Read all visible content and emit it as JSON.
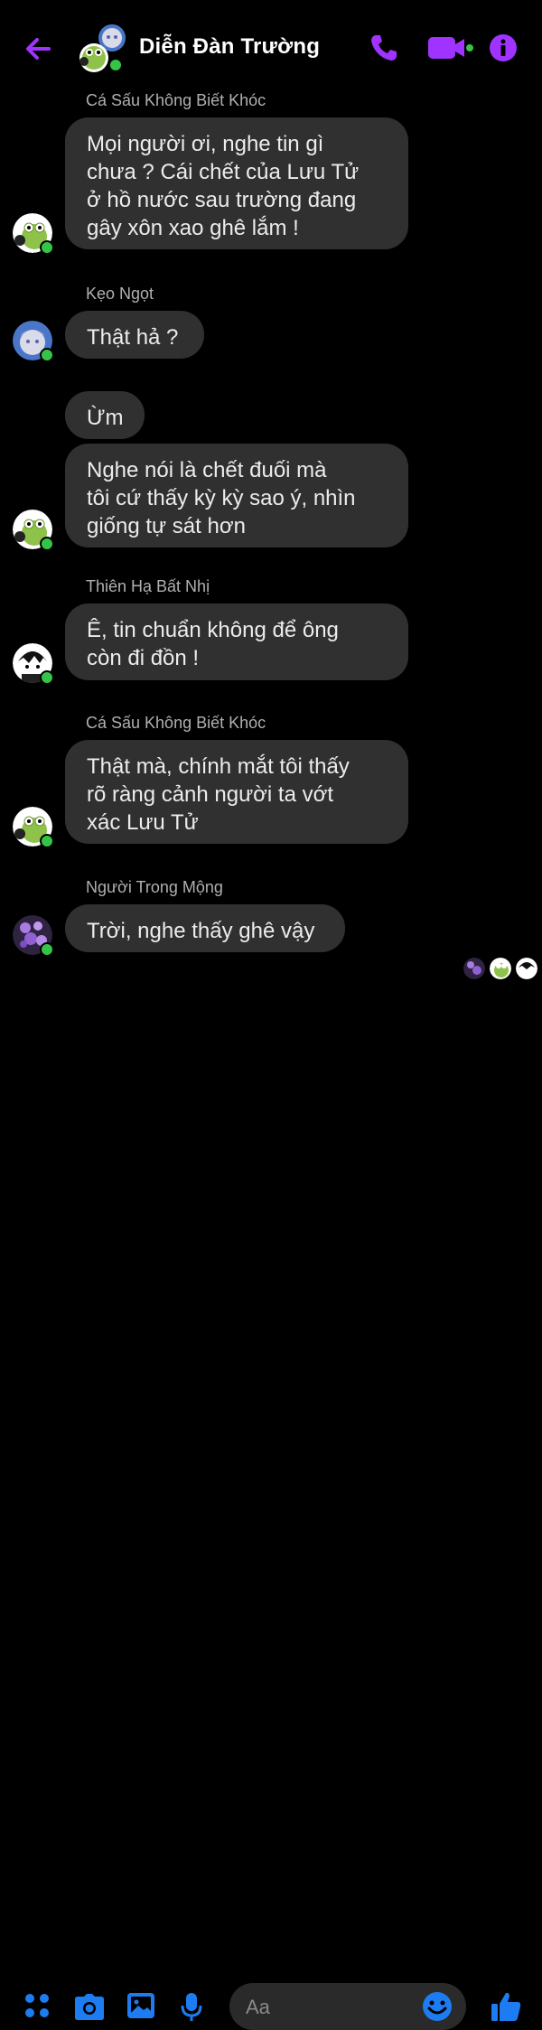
{
  "header": {
    "title": "Diễn Đàn Trường",
    "accent_color": "#a033ff"
  },
  "messages": [
    {
      "sender": "Cá Sấu Không Biết Khóc",
      "lines": [
        "Mọi người ơi, nghe tin gì",
        "chưa ? Cái chết của Lưu Tử",
        "ở hồ nước sau trường đang",
        "gây xôn xao ghê lắm !"
      ]
    },
    {
      "sender": "Kẹo Ngọt",
      "lines": [
        "Thật hả ?"
      ]
    },
    {
      "lines": [
        "Ừm"
      ]
    },
    {
      "lines": [
        "Nghe nói là chết đuối mà",
        "tôi cứ thấy kỳ kỳ sao ý, nhìn",
        "giống tự sát hơn"
      ]
    },
    {
      "sender": "Thiên Hạ Bất Nhị",
      "lines": [
        "Ê, tin chuẩn không để ông",
        "còn đi đồn !"
      ]
    },
    {
      "sender": "Cá Sấu Không Biết Khóc",
      "lines": [
        "Thật mà, chính mắt tôi thấy",
        "rõ ràng cảnh người ta vớt",
        "xác Lưu Tử"
      ]
    },
    {
      "sender": "Người Trong Mộng",
      "lines": [
        "Trời, nghe thấy ghê vậy"
      ]
    }
  ],
  "composer": {
    "placeholder": "Aa",
    "accent_color": "#1e7cf2"
  },
  "colors": {
    "online": "#35c447",
    "bubble": "#303030",
    "background": "#000000"
  }
}
